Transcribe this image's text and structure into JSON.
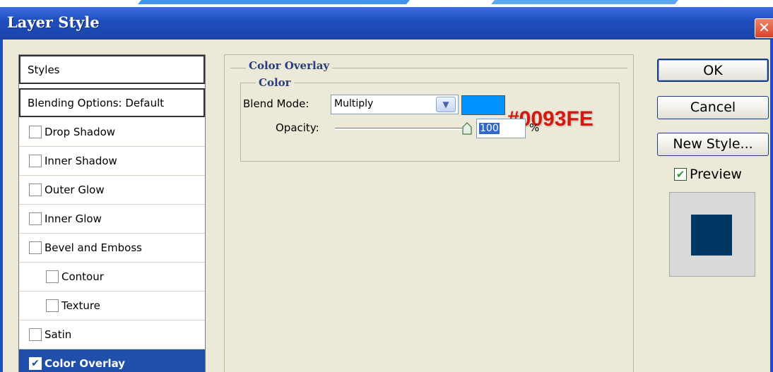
{
  "window": {
    "title": "Layer Style",
    "close_glyph": "✕"
  },
  "styles_list": {
    "items": [
      {
        "label": "Styles",
        "type": "header"
      },
      {
        "label": "Blending Options: Default",
        "type": "header"
      },
      {
        "label": "Drop Shadow",
        "checked": false
      },
      {
        "label": "Inner Shadow",
        "checked": false
      },
      {
        "label": "Outer Glow",
        "checked": false
      },
      {
        "label": "Inner Glow",
        "checked": false
      },
      {
        "label": "Bevel and Emboss",
        "checked": false
      },
      {
        "label": "Contour",
        "checked": false,
        "indent": true
      },
      {
        "label": "Texture",
        "checked": false,
        "indent": true
      },
      {
        "label": "Satin",
        "checked": false
      },
      {
        "label": "Color Overlay",
        "checked": true,
        "selected": true
      }
    ]
  },
  "panel": {
    "group_title": "Color Overlay",
    "subgroup_title": "Color",
    "blend_mode_label": "Blend Mode:",
    "blend_mode_value": "Multiply",
    "overlay_color": "#0093FE",
    "opacity_label": "Opacity:",
    "opacity_value": "100",
    "opacity_unit": "%",
    "opacity_fraction": 1.0
  },
  "annotation": {
    "text": "#0093FE",
    "color": "#d41a10"
  },
  "buttons": {
    "ok": "OK",
    "cancel": "Cancel",
    "new_style": "New Style..."
  },
  "preview": {
    "label": "Preview",
    "checked": true,
    "swatch_color": "#003763"
  },
  "colors": {
    "titlebar": "#1f4fbf",
    "selection": "#1f4fa8",
    "dialog_bg": "#ece9d8"
  }
}
